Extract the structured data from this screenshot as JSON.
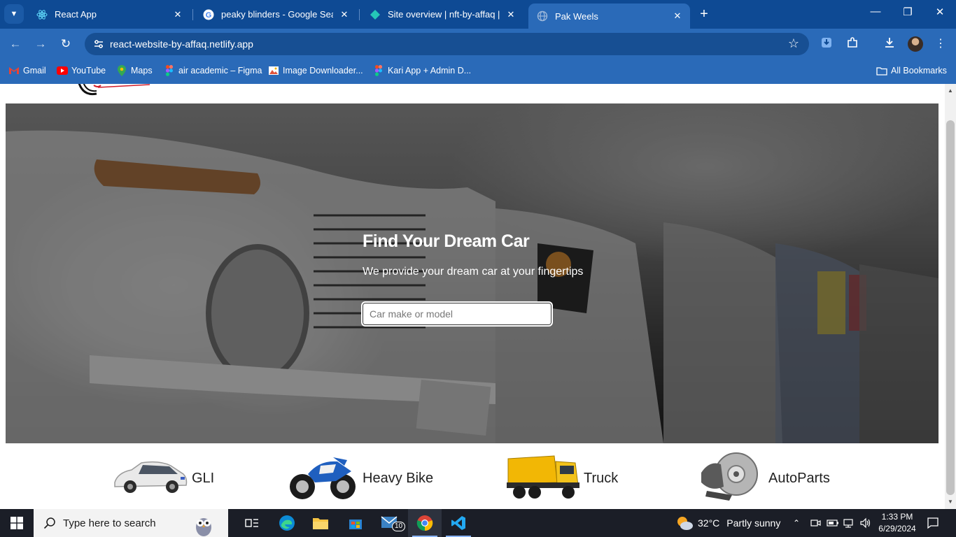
{
  "browser": {
    "tabs": [
      {
        "title": "React App",
        "favicon": "react-icon"
      },
      {
        "title": "peaky blinders - Google Search",
        "favicon": "google-icon"
      },
      {
        "title": "Site overview | nft-by-affaq | Ne",
        "favicon": "netlify-icon"
      },
      {
        "title": "Pak Weels",
        "favicon": "globe-icon",
        "active": true
      }
    ],
    "url": "react-website-by-affaq.netlify.app",
    "bookmarks": [
      {
        "label": "Gmail",
        "icon": "gmail-icon"
      },
      {
        "label": "YouTube",
        "icon": "youtube-icon"
      },
      {
        "label": "Maps",
        "icon": "maps-icon"
      },
      {
        "label": "air academic – Figma",
        "icon": "figma-icon"
      },
      {
        "label": "Image Downloader...",
        "icon": "image-icon"
      },
      {
        "label": "Kari App + Admin D...",
        "icon": "figma-icon"
      }
    ],
    "all_bookmarks": "All Bookmarks"
  },
  "hero": {
    "title": "Find Your Dream Car",
    "subtitle": "We provide your dream car at your fingertips",
    "search_placeholder": "Car make or model"
  },
  "categories": [
    {
      "label": "GLI",
      "icon": "car-icon"
    },
    {
      "label": "Heavy Bike",
      "icon": "motorbike-icon"
    },
    {
      "label": "Truck",
      "icon": "truck-icon"
    },
    {
      "label": "AutoParts",
      "icon": "brake-disc-icon"
    }
  ],
  "taskbar": {
    "search_placeholder": "Type here to search",
    "mail_badge": "10",
    "weather_temp": "32°C",
    "weather_desc": "Partly sunny",
    "time": "1:33 PM",
    "date": "6/29/2024"
  },
  "colors": {
    "chrome_frame": "#0e4a94",
    "chrome_toolbar": "#2a6ab8",
    "taskbar": "#1b1e27"
  }
}
